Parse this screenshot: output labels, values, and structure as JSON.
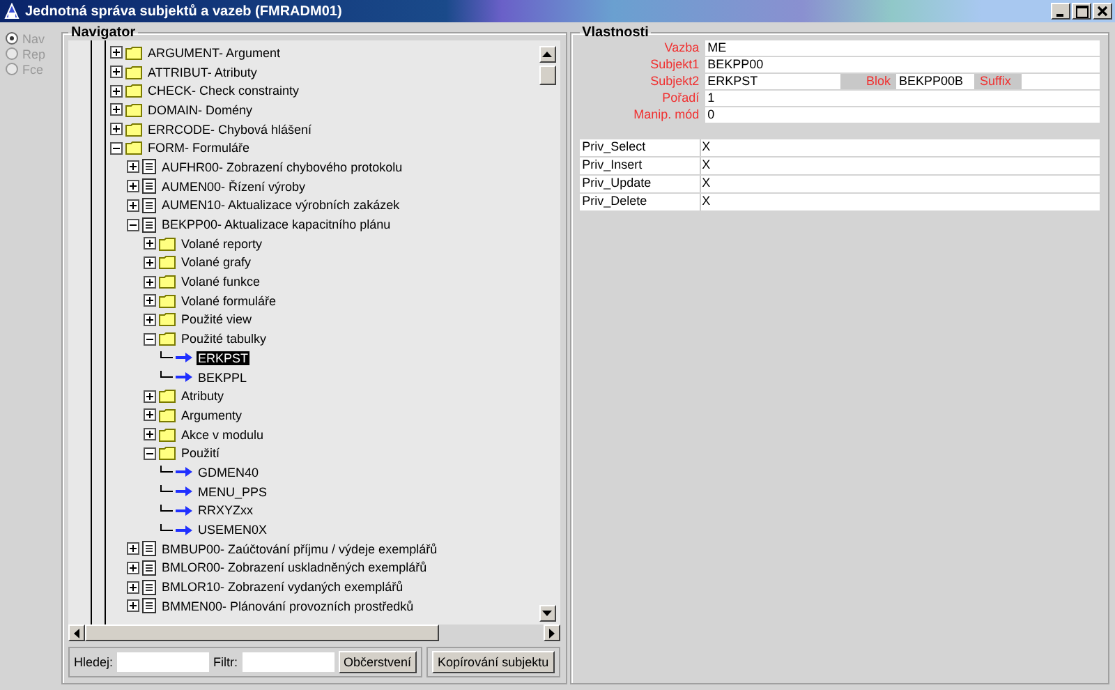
{
  "window": {
    "title": "Jednotná správa subjektů a vazeb (FMRADM01)"
  },
  "modes": [
    {
      "label": "Nav",
      "selected": true,
      "disabled": true
    },
    {
      "label": "Rep",
      "selected": false,
      "disabled": true
    },
    {
      "label": "Fce",
      "selected": false,
      "disabled": true
    }
  ],
  "navigator": {
    "title": "Navigator",
    "tree": [
      {
        "label": "ARGUMENT- Argument",
        "kind": "folder",
        "expanded": false,
        "selected": false
      },
      {
        "label": "ATTRIBUT- Atributy",
        "kind": "folder",
        "expanded": false,
        "selected": false
      },
      {
        "label": "CHECK- Check constrainty",
        "kind": "folder",
        "expanded": false,
        "selected": false
      },
      {
        "label": "DOMAIN- Domény",
        "kind": "folder",
        "expanded": false,
        "selected": false
      },
      {
        "label": "ERRCODE- Chybová hlášení",
        "kind": "folder",
        "expanded": false,
        "selected": false
      },
      {
        "label": "FORM- Formuláře",
        "kind": "folder",
        "expanded": true,
        "selected": false,
        "children": [
          {
            "label": "AUFHR00- Zobrazení chybového protokolu",
            "kind": "module",
            "expanded": false,
            "selected": false
          },
          {
            "label": "AUMEN00- Řízení výroby",
            "kind": "module",
            "expanded": false,
            "selected": false
          },
          {
            "label": "AUMEN10- Aktualizace výrobních zakázek",
            "kind": "module",
            "expanded": false,
            "selected": false
          },
          {
            "label": "BEKPP00- Aktualizace kapacitního plánu",
            "kind": "module",
            "expanded": true,
            "selected": false,
            "children": [
              {
                "label": "Volané reporty",
                "kind": "folder",
                "expanded": false,
                "selected": false
              },
              {
                "label": "Volané grafy",
                "kind": "folder",
                "expanded": false,
                "selected": false
              },
              {
                "label": "Volané funkce",
                "kind": "folder",
                "expanded": false,
                "selected": false
              },
              {
                "label": "Volané formuláře",
                "kind": "folder",
                "expanded": false,
                "selected": false
              },
              {
                "label": "Použité view",
                "kind": "folder",
                "expanded": false,
                "selected": false
              },
              {
                "label": "Použité tabulky",
                "kind": "folder",
                "expanded": true,
                "selected": false,
                "children": [
                  {
                    "label": "ERKPST",
                    "kind": "link",
                    "selected": true
                  },
                  {
                    "label": "BEKPPL",
                    "kind": "link",
                    "selected": false
                  }
                ]
              },
              {
                "label": "Atributy",
                "kind": "folder",
                "expanded": false,
                "selected": false
              },
              {
                "label": "Argumenty",
                "kind": "folder",
                "expanded": false,
                "selected": false
              },
              {
                "label": "Akce v modulu",
                "kind": "folder",
                "expanded": false,
                "selected": false
              },
              {
                "label": "Použití",
                "kind": "folder",
                "expanded": true,
                "selected": false,
                "children": [
                  {
                    "label": "GDMEN40",
                    "kind": "link",
                    "selected": false
                  },
                  {
                    "label": "MENU_PPS",
                    "kind": "link",
                    "selected": false
                  },
                  {
                    "label": "RRXYZxx",
                    "kind": "link",
                    "selected": false
                  },
                  {
                    "label": "USEMEN0X",
                    "kind": "link",
                    "selected": false
                  }
                ]
              }
            ]
          },
          {
            "label": "BMBUP00- Zaúčtování příjmu / výdeje exemplářů",
            "kind": "module",
            "expanded": false,
            "selected": false
          },
          {
            "label": "BMLOR00- Zobrazení uskladněných exemplářů",
            "kind": "module",
            "expanded": false,
            "selected": false
          },
          {
            "label": "BMLOR10- Zobrazení vydaných exemplářů",
            "kind": "module",
            "expanded": false,
            "selected": false
          },
          {
            "label": "BMMEN00- Plánování provozních prostředků",
            "kind": "module",
            "expanded": false,
            "selected": false
          }
        ]
      }
    ]
  },
  "search": {
    "label": "Hledej:"
  },
  "filter": {
    "label": "Filtr:"
  },
  "refresh_button": "Občerstvení",
  "copy_button": "Kopírování subjektu",
  "properties": {
    "title": "Vlastnosti",
    "fields": [
      {
        "label": "Vazba",
        "value": "ME"
      },
      {
        "label": "Subjekt1",
        "value": "BEKPP00"
      },
      {
        "label": "Subjekt2",
        "value": "ERKPST",
        "extras": [
          {
            "label": "Blok",
            "value": "BEKPP00B"
          },
          {
            "label": "Suffix"
          }
        ]
      },
      {
        "label": "Pořadí",
        "value": "1"
      },
      {
        "label": "Manip. mód",
        "value": "0"
      }
    ],
    "privileges": [
      {
        "name": "Priv_Select",
        "value": "X"
      },
      {
        "name": "Priv_Insert",
        "value": "X"
      },
      {
        "name": "Priv_Update",
        "value": "X"
      },
      {
        "name": "Priv_Delete",
        "value": "X"
      }
    ]
  }
}
